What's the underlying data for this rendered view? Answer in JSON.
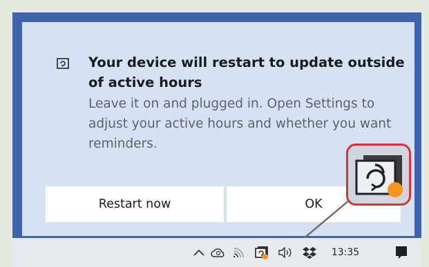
{
  "toast": {
    "icon": "sync-update-icon",
    "title": "Your device will restart to update outside of active hours",
    "body": "Leave it on and plugged in. Open Settings to adjust your active hours and whether you want reminders.",
    "restart_label": "Restart now",
    "ok_label": "OK"
  },
  "callout": {
    "icon": "windows-update-pending-icon",
    "border_color": "#d8313c",
    "badge_color": "#f7961d"
  },
  "taskbar": {
    "icons": [
      "chevron-up-icon",
      "onedrive-icon",
      "network-icon",
      "windows-update-icon",
      "volume-icon",
      "dropbox-icon",
      "notification-icon"
    ],
    "time": "13:35"
  },
  "colors": {
    "desktop": "#3d63b1",
    "toast_bg": "#d6e1f1",
    "taskbar_bg": "#e7ebed"
  }
}
